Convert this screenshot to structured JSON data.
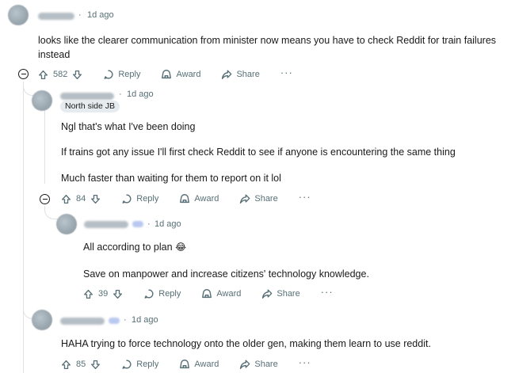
{
  "comments": [
    {
      "time": "1d ago",
      "lines": [
        "looks like the clearer communication from minister now means you have to check Reddit for train failures instead"
      ],
      "score": "582"
    },
    {
      "time": "1d ago",
      "flair": "North side JB",
      "lines": [
        "Ngl that's what I've been doing",
        "If trains got any issue I'll first check Reddit to see if anyone is encountering the same thing",
        "Much faster than waiting for them to report on it lol"
      ],
      "score": "84"
    },
    {
      "time": "1d ago",
      "lines": [
        "All according to plan",
        "Save on manpower and increase citizens' technology knowledge."
      ],
      "score": "39"
    },
    {
      "time": "1d ago",
      "lines": [
        "HAHA trying to force technology onto the older gen, making them learn to use reddit."
      ],
      "score": "85"
    }
  ],
  "actions": {
    "reply": "Reply",
    "award": "Award",
    "share": "Share",
    "more": "···"
  },
  "separator": "·",
  "emoji": "😂"
}
